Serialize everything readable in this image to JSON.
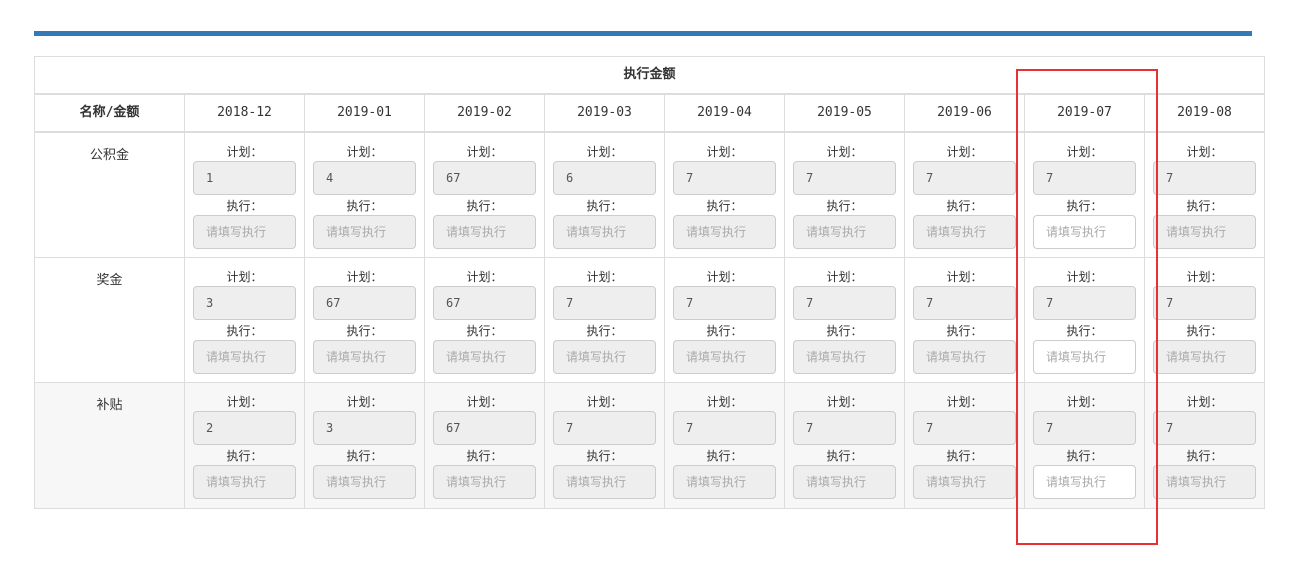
{
  "table": {
    "title": "执行金额",
    "name_header": "名称/金额",
    "months": [
      "2018-12",
      "2019-01",
      "2019-02",
      "2019-03",
      "2019-04",
      "2019-05",
      "2019-06",
      "2019-07",
      "2019-08"
    ],
    "plan_label": "计划：",
    "exec_label": "执行：",
    "exec_placeholder": "请填写执行",
    "rows": [
      {
        "name": "公积金",
        "plans": [
          "1",
          "4",
          "67",
          "6",
          "7",
          "7",
          "7",
          "7",
          "7"
        ]
      },
      {
        "name": "奖金",
        "plans": [
          "3",
          "67",
          "67",
          "7",
          "7",
          "7",
          "7",
          "7",
          "7"
        ]
      },
      {
        "name": "补贴",
        "plans": [
          "2",
          "3",
          "67",
          "7",
          "7",
          "7",
          "7",
          "7",
          "7"
        ]
      }
    ],
    "editable_month_index": 7
  },
  "colors": {
    "accent_bar": "#337ab7",
    "highlight_box": "#e53333",
    "disabled_input_bg": "#eeeeee",
    "border": "#dddddd"
  }
}
